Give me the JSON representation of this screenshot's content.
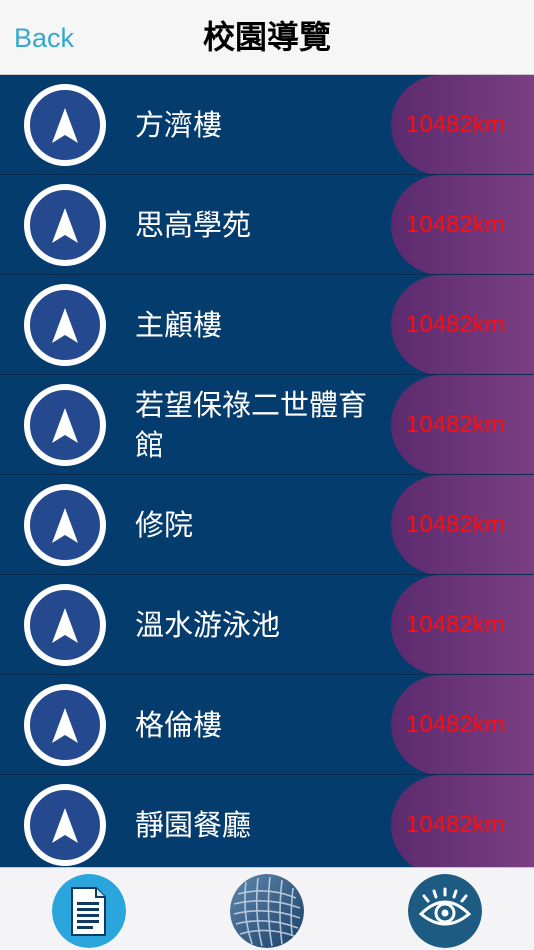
{
  "header": {
    "back_label": "Back",
    "title": "校園導覽"
  },
  "colors": {
    "row_background": "#053c6e",
    "distance_gradient_start": "#5b2a6e",
    "distance_gradient_end": "#8a4a8c",
    "distance_text": "#ff0d0d",
    "back_button": "#35a8cc",
    "nav_icon": "#24498e"
  },
  "places": [
    {
      "name": "方濟樓",
      "distance": "10482km"
    },
    {
      "name": "思高學苑",
      "distance": "10482km"
    },
    {
      "name": "主顧樓",
      "distance": "10482km"
    },
    {
      "name": "若望保祿二世體育館",
      "distance": "10482km"
    },
    {
      "name": "修院",
      "distance": "10482km"
    },
    {
      "name": "溫水游泳池",
      "distance": "10482km"
    },
    {
      "name": "格倫樓",
      "distance": "10482km"
    },
    {
      "name": "靜園餐廳",
      "distance": "10482km"
    }
  ],
  "tabs": [
    {
      "icon": "document-icon",
      "color": "#2aa6dc"
    },
    {
      "icon": "grid-map-icon",
      "color": "#234f7b"
    },
    {
      "icon": "eye-icon",
      "color": "#1d5b82"
    }
  ]
}
